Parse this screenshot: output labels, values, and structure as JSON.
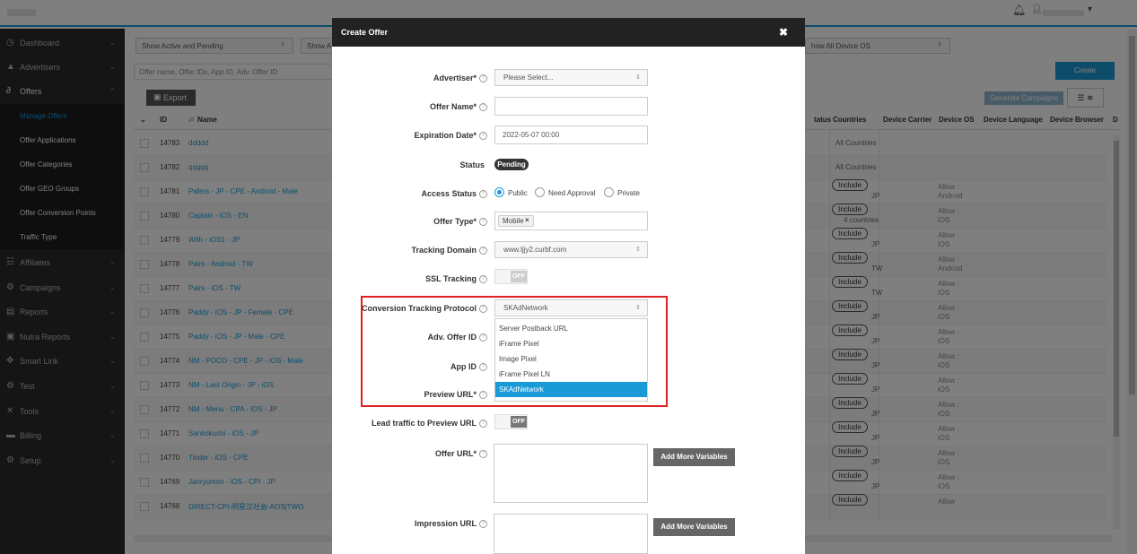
{
  "app": {
    "title_bar_placeholder": ""
  },
  "topbar": {
    "bell_icon": "bell-icon",
    "user_icon": "user-icon",
    "caret": "▾"
  },
  "sidebar": {
    "items": [
      {
        "label": "Dashboard",
        "icon": "dashboard-icon",
        "glyph": "◷"
      },
      {
        "label": "Advertisers",
        "icon": "advertiser-icon",
        "glyph": "👤"
      },
      {
        "label": "Offers",
        "icon": "link-icon",
        "glyph": "🔗"
      },
      {
        "label": "Affiliates",
        "icon": "affiliates-icon",
        "glyph": "👥"
      },
      {
        "label": "Campaigns",
        "icon": "campaigns-icon",
        "glyph": "⚙"
      },
      {
        "label": "Reports",
        "icon": "reports-icon",
        "glyph": "▤"
      },
      {
        "label": "Nutra Reports",
        "icon": "nutra-reports-icon",
        "glyph": "▣"
      },
      {
        "label": "Smart Link",
        "icon": "smart-link-icon",
        "glyph": "⚯"
      },
      {
        "label": "Test",
        "icon": "test-icon",
        "glyph": "⚙"
      },
      {
        "label": "Tools",
        "icon": "tools-icon",
        "glyph": "✂"
      },
      {
        "label": "Billing",
        "icon": "billing-icon",
        "glyph": "▬"
      },
      {
        "label": "Setup",
        "icon": "setup-icon",
        "glyph": "⚙"
      }
    ],
    "offers_sub": [
      {
        "label": "Manage Offers"
      },
      {
        "label": "Offer Applications"
      },
      {
        "label": "Offer Categories"
      },
      {
        "label": "Offer GEO Groups"
      },
      {
        "label": "Offer Conversion Points"
      },
      {
        "label": "Traffic Type"
      }
    ]
  },
  "main": {
    "filter1": "Show Active and Pending",
    "filter2": "Show A",
    "filter_os": "how All Device OS",
    "search_placeholder": "Offer name, Offer IDs, App ID, Adv. Offer ID",
    "create_label": "Create",
    "export_label": "Export",
    "generate_label": "Generate Campaigns",
    "col_btn": "☰ ≑",
    "headers": {
      "id": "ID",
      "name": "Name",
      "status": "tatus",
      "countries": "Countries",
      "carrier": "Device Carrier",
      "os": "Device OS",
      "language": "Device Language",
      "browser": "Device Browser",
      "more": "D"
    },
    "rows": [
      {
        "id": "14783",
        "name": "ddddd",
        "country": "All Countries",
        "pill": "",
        "sub": "",
        "os1": "",
        "os2": ""
      },
      {
        "id": "14782",
        "name": "qqqqq",
        "country": "All Countries",
        "pill": "",
        "sub": "",
        "os1": "",
        "os2": ""
      },
      {
        "id": "14781",
        "name": "Pafers - JP - CPE - Android - Male",
        "country": "",
        "pill": "Include",
        "sub": "JP",
        "os1": "Allow :",
        "os2": "Android"
      },
      {
        "id": "14780",
        "name": "Captain - iOS - EN",
        "country": "",
        "pill": "Include",
        "sub": "4 countries",
        "os1": "Allow :",
        "os2": "iOS"
      },
      {
        "id": "14779",
        "name": "With - iOS1 - JP",
        "country": "",
        "pill": "Include",
        "sub": "JP",
        "os1": "Allow :",
        "os2": "iOS"
      },
      {
        "id": "14778",
        "name": "Pairs - Android - TW",
        "country": "",
        "pill": "Include",
        "sub": "TW",
        "os1": "Allow :",
        "os2": "Android"
      },
      {
        "id": "14777",
        "name": "Pairs - iOS - TW",
        "country": "",
        "pill": "Include",
        "sub": "TW",
        "os1": "Allow :",
        "os2": "iOS"
      },
      {
        "id": "14776",
        "name": "Paddy - iOS - JP - Female - CPE",
        "country": "",
        "pill": "Include",
        "sub": "JP",
        "os1": "Allow :",
        "os2": "iOS"
      },
      {
        "id": "14775",
        "name": "Paddy - iOS - JP - Male - CPE",
        "country": "",
        "pill": "Include",
        "sub": "JP",
        "os1": "Allow :",
        "os2": "iOS"
      },
      {
        "id": "14774",
        "name": "NM - POCO - CPE - JP - iOS - Male",
        "country": "",
        "pill": "Include",
        "sub": "JP",
        "os1": "Allow :",
        "os2": "iOS"
      },
      {
        "id": "14773",
        "name": "NM - Last Origin - JP - iOS",
        "country": "",
        "pill": "Include",
        "sub": "JP",
        "os1": "Allow :",
        "os2": "iOS"
      },
      {
        "id": "14772",
        "name": "NM - Menu - CPA - iOS - JP",
        "country": "",
        "pill": "Include",
        "sub": "JP",
        "os1": "Allow :",
        "os2": "iOS"
      },
      {
        "id": "14771",
        "name": "Sankokushi - iOS - JP",
        "country": "",
        "pill": "Include",
        "sub": "JP",
        "os1": "Allow :",
        "os2": "iOS"
      },
      {
        "id": "14770",
        "name": "Tinder - iOS - CPE",
        "country": "",
        "pill": "Include",
        "sub": "JP",
        "os1": "Allow :",
        "os2": "iOS"
      },
      {
        "id": "14769",
        "name": "Janryumon - iOS - CPI - JP",
        "country": "",
        "pill": "Include",
        "sub": "JP",
        "os1": "Allow :",
        "os2": "iOS"
      },
      {
        "id": "14768",
        "name": "DIRECT-CPI-明星汉社会-AOS|TWO",
        "country": "",
        "pill": "Include",
        "sub": "",
        "os1": "Allow",
        "os2": ""
      }
    ]
  },
  "modal": {
    "title": "Create Offer",
    "close": "✖",
    "advertiser_label": "Advertiser*",
    "advertiser_value": "Please Select...",
    "offer_name_label": "Offer Name*",
    "offer_name_value": "",
    "expiration_label": "Expiration Date*",
    "expiration_value": "2022-05-07 00:00",
    "status_label": "Status",
    "status_value": "Pending",
    "access_label": "Access Status",
    "access_options": [
      "Public",
      "Need Approval",
      "Private"
    ],
    "offer_type_label": "Offer Type*",
    "offer_type_tag": "Mobile",
    "tracking_domain_label": "Tracking Domain",
    "tracking_domain_value": "www.ljjy2.curbf.com",
    "ssl_label": "SSL Tracking",
    "ssl_value": "OFF",
    "conversion_label": "Conversion Tracking Protocol",
    "conversion_value": "SKAdNetwork",
    "conversion_options": [
      "Server Postback URL",
      "iFrame Pixel",
      "Image Pixel",
      "iFrame Pixel LN",
      "SKAdNetwork"
    ],
    "adv_offer_id_label": "Adv. Offer ID",
    "app_id_label": "App ID",
    "preview_url_label": "Preview URL*",
    "lead_traffic_label": "Lead traffic to Preview URL",
    "lead_traffic_value": "OFF",
    "offer_url_label": "Offer URL*",
    "impression_url_label": "Impression URL",
    "add_vars_label": "Add More Variables",
    "help": "?"
  },
  "colors": {
    "accent": "#1a9bd7",
    "sidebar": "#2b2b2b",
    "highlight": "#e02020"
  }
}
